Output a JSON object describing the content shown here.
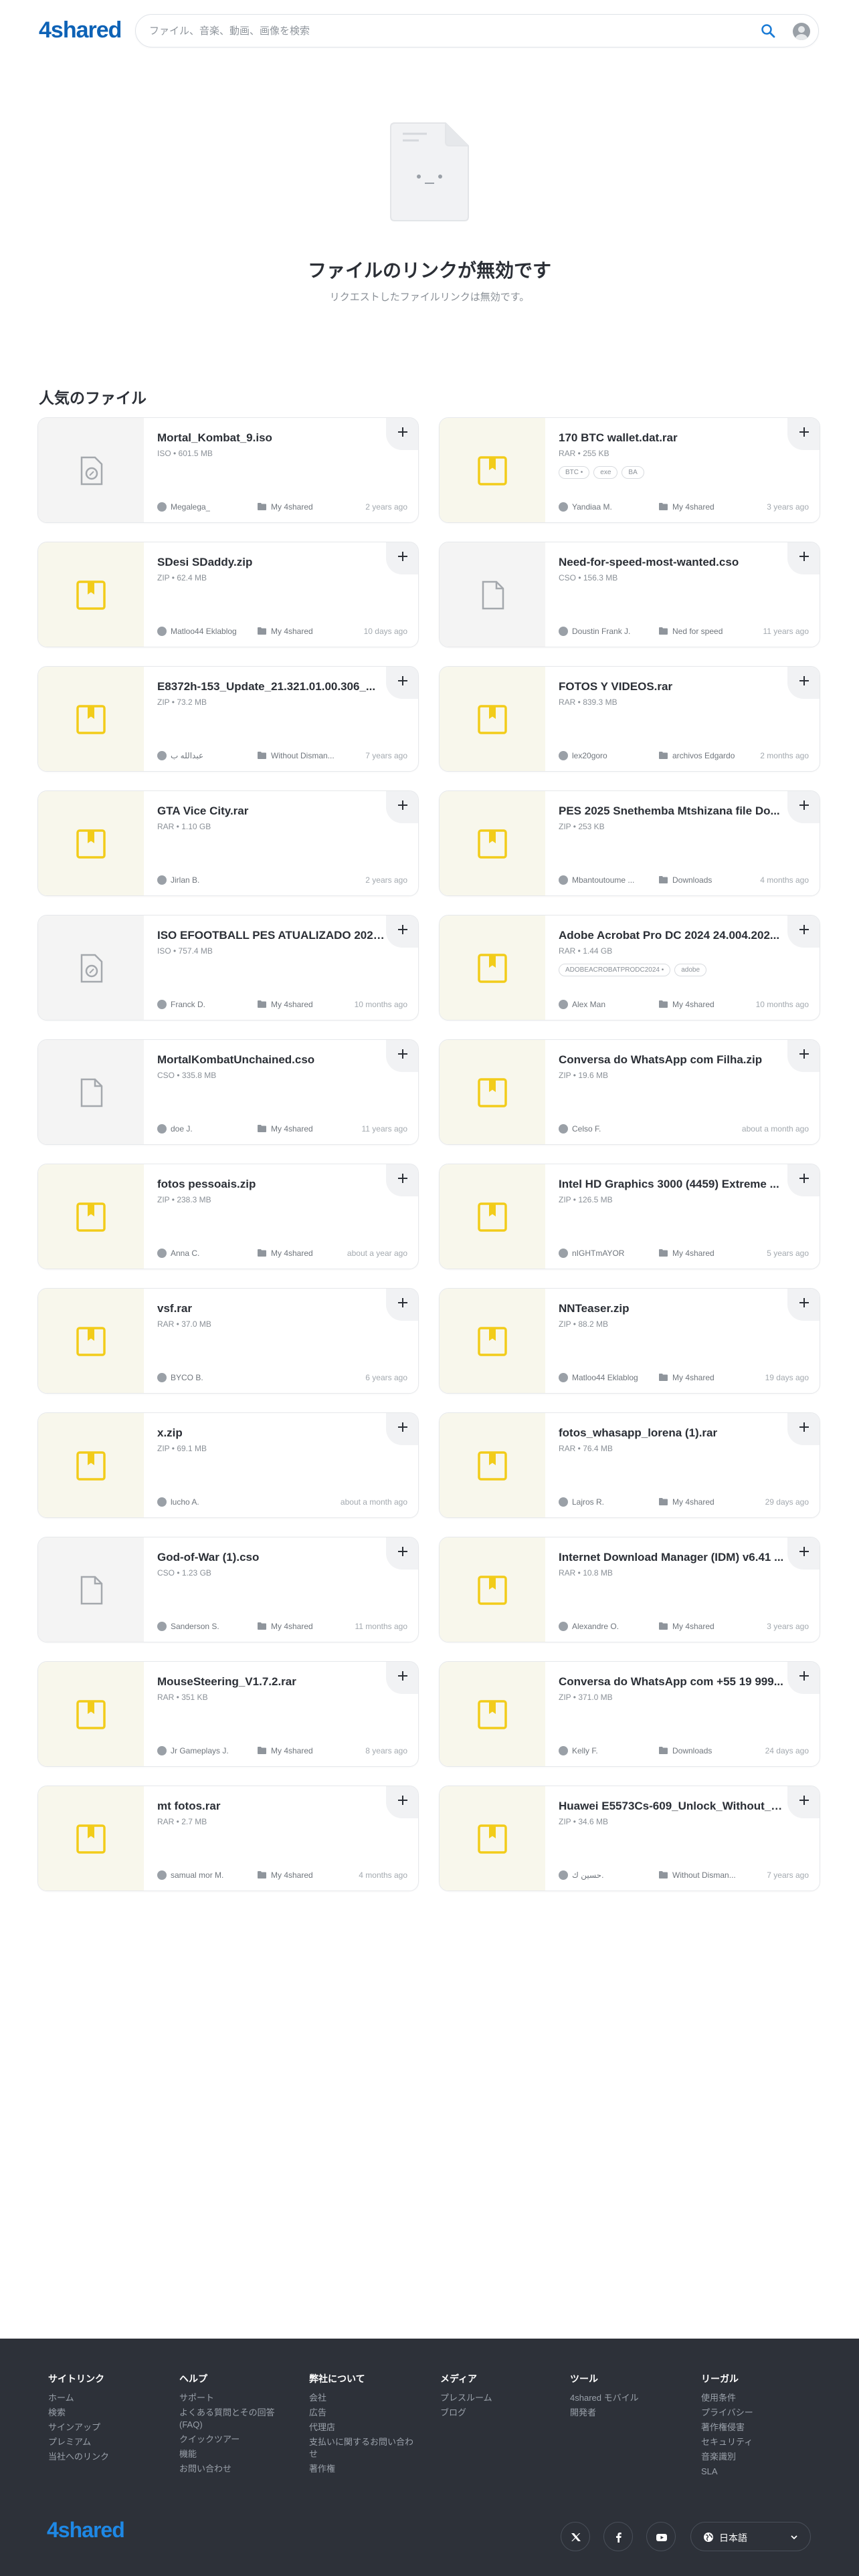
{
  "header": {
    "logo": "4shared",
    "search_placeholder": "ファイル、音楽、動画、画像を検索"
  },
  "hero": {
    "title": "ファイルのリンクが無効です",
    "subtitle": "リクエストしたファイルリンクは無効です。"
  },
  "popular": {
    "title": "人気のファイル",
    "files": [
      {
        "name": "Mortal_Kombat_9.iso",
        "meta": "ISO • 601.5 MB",
        "user": "Megalega_",
        "folder": "My 4shared",
        "age": "2 years ago",
        "icon": "disc",
        "tags": []
      },
      {
        "name": "170 BTC wallet.dat.rar",
        "meta": "RAR • 255 KB",
        "user": "Yandiaa M.",
        "folder": "My 4shared",
        "age": "3 years ago",
        "icon": "archive",
        "tags": [
          "BTC •",
          "exe",
          "BA"
        ]
      },
      {
        "name": "SDesi SDaddy.zip",
        "meta": "ZIP • 62.4 MB",
        "user": "Matloo44 Eklablog",
        "folder": "My 4shared",
        "age": "10 days ago",
        "icon": "archive",
        "tags": []
      },
      {
        "name": "Need-for-speed-most-wanted.cso",
        "meta": "CSO • 156.3 MB",
        "user": "Doustin Frank J.",
        "folder": "Ned for speed",
        "age": "11 years ago",
        "icon": "doc",
        "tags": []
      },
      {
        "name": "E8372h-153_Update_21.321.01.00.306_...",
        "meta": "ZIP • 73.2 MB",
        "user": "عبدالله ب",
        "folder": "Without Disman...",
        "age": "7 years ago",
        "icon": "archive",
        "tags": []
      },
      {
        "name": "FOTOS Y VIDEOS.rar",
        "meta": "RAR • 839.3 MB",
        "user": "lex20goro",
        "folder": "archivos Edgardo",
        "age": "2 months ago",
        "icon": "archive",
        "tags": []
      },
      {
        "name": "GTA Vice City.rar",
        "meta": "RAR • 1.10 GB",
        "user": "Jirlan B.",
        "folder": "",
        "age": "2 years ago",
        "icon": "archive",
        "tags": []
      },
      {
        "name": "PES 2025 Snethemba Mtshizana file Do...",
        "meta": "ZIP • 253 KB",
        "user": "Mbantoutoume ...",
        "folder": "Downloads",
        "age": "4 months ago",
        "icon": "archive",
        "tags": []
      },
      {
        "name": "ISO EFOOTBALL PES ATUALIZADO 2025...",
        "meta": "ISO • 757.4 MB",
        "user": "Franck D.",
        "folder": "My 4shared",
        "age": "10 months ago",
        "icon": "disc",
        "tags": []
      },
      {
        "name": "Adobe Acrobat Pro DC 2024 24.004.202...",
        "meta": "RAR • 1.44 GB",
        "user": "Alex Man",
        "folder": "My 4shared",
        "age": "10 months ago",
        "icon": "archive",
        "tags": [
          "ADOBEACROBATPRODC2024 •",
          "adobe"
        ]
      },
      {
        "name": "MortalKombatUnchained.cso",
        "meta": "CSO • 335.8 MB",
        "user": "doe J.",
        "folder": "My 4shared",
        "age": "11 years ago",
        "icon": "doc",
        "tags": []
      },
      {
        "name": "Conversa do WhatsApp com Filha.zip",
        "meta": "ZIP • 19.6 MB",
        "user": "Celso F.",
        "folder": "",
        "age": "about a month ago",
        "icon": "archive",
        "tags": []
      },
      {
        "name": "fotos pessoais.zip",
        "meta": "ZIP • 238.3 MB",
        "user": "Anna C.",
        "folder": "My 4shared",
        "age": "about a year ago",
        "icon": "archive",
        "tags": []
      },
      {
        "name": "Intel HD Graphics 3000 (4459) Extreme ...",
        "meta": "ZIP • 126.5 MB",
        "user": "nIGHTmAYOR",
        "folder": "My 4shared",
        "age": "5 years ago",
        "icon": "archive",
        "tags": []
      },
      {
        "name": "vsf.rar",
        "meta": "RAR • 37.0 MB",
        "user": "BYCO B.",
        "folder": "",
        "age": "6 years ago",
        "icon": "archive",
        "tags": []
      },
      {
        "name": "NNTeaser.zip",
        "meta": "ZIP • 88.2 MB",
        "user": "Matloo44 Eklablog",
        "folder": "My 4shared",
        "age": "19 days ago",
        "icon": "archive",
        "tags": []
      },
      {
        "name": "x.zip",
        "meta": "ZIP • 69.1 MB",
        "user": "lucho A.",
        "folder": "",
        "age": "about a month ago",
        "icon": "archive",
        "tags": []
      },
      {
        "name": "fotos_whasapp_lorena (1).rar",
        "meta": "RAR • 76.4 MB",
        "user": "Lajros R.",
        "folder": "My 4shared",
        "age": "29 days ago",
        "icon": "archive",
        "tags": []
      },
      {
        "name": "God-of-War (1).cso",
        "meta": "CSO • 1.23 GB",
        "user": "Sanderson S.",
        "folder": "My 4shared",
        "age": "11 months ago",
        "icon": "doc",
        "tags": []
      },
      {
        "name": "Internet Download Manager (IDM) v6.41 ...",
        "meta": "RAR • 10.8 MB",
        "user": "Alexandre O.",
        "folder": "My 4shared",
        "age": "3 years ago",
        "icon": "archive",
        "tags": []
      },
      {
        "name": "MouseSteering_V1.7.2.rar",
        "meta": "RAR • 351 KB",
        "user": "Jr Gameplays J.",
        "folder": "My 4shared",
        "age": "8 years ago",
        "icon": "archive",
        "tags": []
      },
      {
        "name": "Conversa do WhatsApp com +55 19 999...",
        "meta": "ZIP • 371.0 MB",
        "user": "Kelly F.",
        "folder": "Downloads",
        "age": "24 days ago",
        "icon": "archive",
        "tags": []
      },
      {
        "name": "mt fotos.rar",
        "meta": "RAR • 2.7 MB",
        "user": "samual mor M.",
        "folder": "My 4shared",
        "age": "4 months ago",
        "icon": "archive",
        "tags": []
      },
      {
        "name": "Huawei E5573Cs-609_Unlock_Without_D...",
        "meta": "ZIP • 34.6 MB",
        "user": "حسين ك.",
        "folder": "Without Disman...",
        "age": "7 years ago",
        "icon": "archive",
        "tags": []
      }
    ]
  },
  "footer": {
    "logo": "4shared",
    "columns": [
      {
        "title": "サイトリンク",
        "links": [
          "ホーム",
          "検索",
          "サインアップ",
          "プレミアム",
          "当社へのリンク"
        ]
      },
      {
        "title": "ヘルプ",
        "links": [
          "サポート",
          "よくある質問とその回答 (FAQ)",
          "クイックツアー",
          "機能",
          "お問い合わせ"
        ]
      },
      {
        "title": "弊社について",
        "links": [
          "会社",
          "広告",
          "代理店",
          "支払いに関するお問い合わせ",
          "著作権"
        ]
      },
      {
        "title": "メディア",
        "links": [
          "プレスルーム",
          "ブログ"
        ]
      },
      {
        "title": "ツール",
        "links": [
          "4shared モバイル",
          "開発者"
        ]
      },
      {
        "title": "リーガル",
        "links": [
          "使用条件",
          "プライバシー",
          "著作権侵害",
          "セキュリティ",
          "音楽識別",
          "SLA"
        ]
      }
    ],
    "language": "日本語"
  }
}
